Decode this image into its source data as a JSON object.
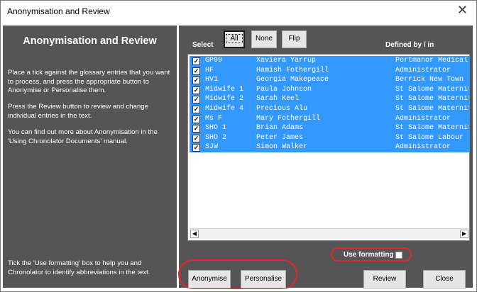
{
  "window": {
    "title": "Anonymisation and Review",
    "close_glyph": "✕"
  },
  "left_panel": {
    "heading": "Anonymisation and Review",
    "para1": "Place a tick against the glossary entries that you want to process, and press the appropriate button to Anonymise or Personalise them.",
    "para2": "Press the Review button to review and change individual entries in the text.",
    "para3": "You can find out more about Anonymisation in the 'Using Chronolator Documents' manual.",
    "para4": "Tick the 'Use formatting' box to help you and Chronolator to identify abbreviations in the text."
  },
  "select": {
    "label": "Select",
    "all": "All",
    "none": "None",
    "flip": "Flip"
  },
  "defined_label": "Defined by / in",
  "entries": [
    {
      "abbr": "GP99",
      "name": "Xaviera Yarrup",
      "defined": "Portmanor Medical",
      "checked": true
    },
    {
      "abbr": "HF",
      "name": "Hamish Fothergill",
      "defined": "Administrator",
      "checked": true
    },
    {
      "abbr": "HV1",
      "name": "Georgia Makepeace",
      "defined": "Berrick New Town",
      "checked": true
    },
    {
      "abbr": "Midwife 1",
      "name": "Paula Johnson",
      "defined": "St Salome Maternity",
      "checked": true
    },
    {
      "abbr": "Midwife 2",
      "name": "Sarah Keel",
      "defined": "St Salome Maternity",
      "checked": true
    },
    {
      "abbr": "Midwife 4",
      "name": "Precious Alu",
      "defined": "St Salome Maternity",
      "checked": true
    },
    {
      "abbr": "Ms F",
      "name": "Mary Fothergill",
      "defined": "Administrator",
      "checked": true
    },
    {
      "abbr": "SHO 1",
      "name": "Brian Adams",
      "defined": "St Salome Maternity",
      "checked": true
    },
    {
      "abbr": "SHO 2",
      "name": "Peter James",
      "defined": "St Salome Labour",
      "checked": true
    },
    {
      "abbr": "SJW",
      "name": "Simon Walker",
      "defined": "Administrator",
      "checked": true
    }
  ],
  "use_formatting": {
    "label": "Use formatting",
    "checked": false
  },
  "buttons": {
    "anonymise": "Anonymise",
    "personalise": "Personalise",
    "review": "Review",
    "close": "Close"
  },
  "colors": {
    "panel": "#555555",
    "selection": "#3399ff",
    "highlight_ring": "#e3262b"
  },
  "icons": {
    "scroll_left": "◀",
    "scroll_right": "▶",
    "check": "✓"
  }
}
